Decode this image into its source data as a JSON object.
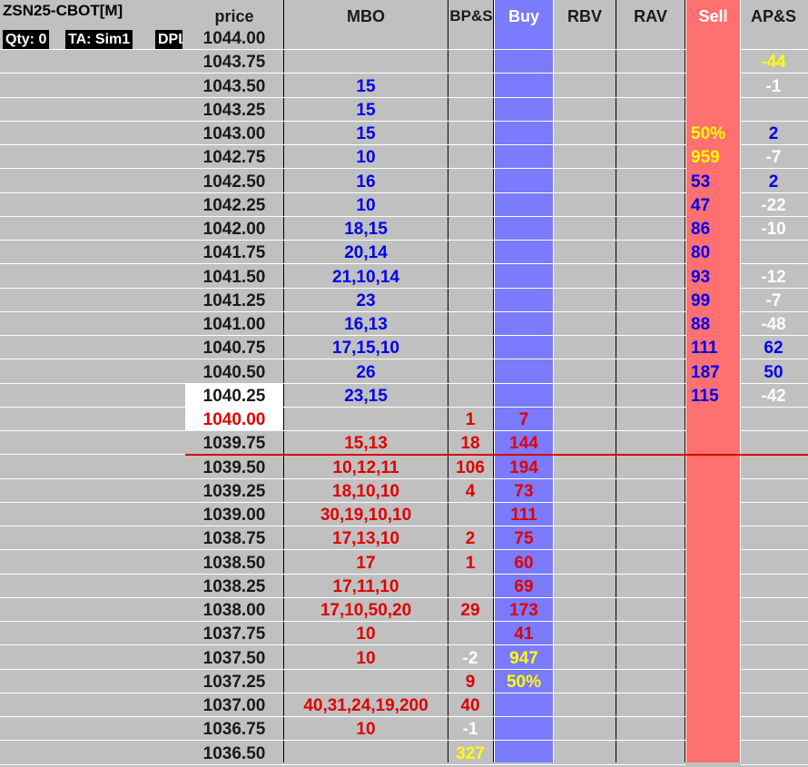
{
  "title": "ZSN25-CBOT[M]",
  "qty": "Qty: 0",
  "ta": "TA: Sim1",
  "dpl": "DPL",
  "headers": {
    "price": "price",
    "mbo": "MBO",
    "bps": "BP&S",
    "buy": "Buy",
    "rbv": "RBV",
    "rav": "RAV",
    "sell": "Sell",
    "aps": "AP&S"
  },
  "colors": {
    "background": "#c0c0c0",
    "buy_column": "#7b7bff",
    "sell_column": "#ff7171",
    "bid_text": "#e00000",
    "ask_text": "#0000ee",
    "last_trade_line": "#dd0000"
  },
  "rows": [
    {
      "price": "1044.00",
      "mbo": "",
      "bps": "",
      "buy": "",
      "sell": "",
      "aps": ""
    },
    {
      "price": "1043.75",
      "mbo": "",
      "bps": "",
      "buy": "",
      "sell": "",
      "aps": "-44",
      "aps_color": "yellow"
    },
    {
      "price": "1043.50",
      "mbo": "15",
      "mbo_color": "blue",
      "bps": "",
      "buy": "",
      "sell": "",
      "aps": "-1",
      "aps_color": "white"
    },
    {
      "price": "1043.25",
      "mbo": "15",
      "mbo_color": "blue",
      "bps": "",
      "buy": "",
      "sell": "",
      "aps": ""
    },
    {
      "price": "1043.00",
      "mbo": "15",
      "mbo_color": "blue",
      "bps": "",
      "buy": "",
      "sell": "50%",
      "sell_color": "yellow",
      "aps": "2",
      "aps_color": "blue"
    },
    {
      "price": "1042.75",
      "mbo": "10",
      "mbo_color": "blue",
      "bps": "",
      "buy": "",
      "sell": "959",
      "sell_color": "yellow",
      "aps": "-7",
      "aps_color": "white"
    },
    {
      "price": "1042.50",
      "mbo": "16",
      "mbo_color": "blue",
      "bps": "",
      "buy": "",
      "sell": "53",
      "sell_color": "blue",
      "aps": "2",
      "aps_color": "blue"
    },
    {
      "price": "1042.25",
      "mbo": "10",
      "mbo_color": "blue",
      "bps": "",
      "buy": "",
      "sell": "47",
      "sell_color": "blue",
      "aps": "-22",
      "aps_color": "white"
    },
    {
      "price": "1042.00",
      "mbo": "18,15",
      "mbo_color": "blue",
      "bps": "",
      "buy": "",
      "sell": "86",
      "sell_color": "blue",
      "aps": "-10",
      "aps_color": "white"
    },
    {
      "price": "1041.75",
      "mbo": "20,14",
      "mbo_color": "blue",
      "bps": "",
      "buy": "",
      "sell": "80",
      "sell_color": "blue",
      "aps": ""
    },
    {
      "price": "1041.50",
      "mbo": "21,10,14",
      "mbo_color": "blue",
      "bps": "",
      "buy": "",
      "sell": "93",
      "sell_color": "blue",
      "aps": "-12",
      "aps_color": "white"
    },
    {
      "price": "1041.25",
      "mbo": "23",
      "mbo_color": "blue",
      "bps": "",
      "buy": "",
      "sell": "99",
      "sell_color": "blue",
      "aps": "-7",
      "aps_color": "white"
    },
    {
      "price": "1041.00",
      "mbo": "16,13",
      "mbo_color": "blue",
      "bps": "",
      "buy": "",
      "sell": "88",
      "sell_color": "blue",
      "aps": "-48",
      "aps_color": "white"
    },
    {
      "price": "1040.75",
      "mbo": "17,15,10",
      "mbo_color": "blue",
      "bps": "",
      "buy": "",
      "sell": "111",
      "sell_color": "blue",
      "aps": "62",
      "aps_color": "blue"
    },
    {
      "price": "1040.50",
      "mbo": "26",
      "mbo_color": "blue",
      "bps": "",
      "buy": "",
      "sell": "187",
      "sell_color": "blue",
      "aps": "50",
      "aps_color": "blue"
    },
    {
      "price": "1040.25",
      "price_hl": true,
      "mbo": "23,15",
      "mbo_color": "blue",
      "bps": "",
      "buy": "",
      "sell": "115",
      "sell_color": "blue",
      "aps": "-42",
      "aps_color": "white"
    },
    {
      "price": "1040.00",
      "price_hl": true,
      "price_color": "red",
      "mbo": "",
      "bps": "1",
      "bps_color": "red",
      "buy": "7",
      "buy_color": "red",
      "sell": "",
      "aps": ""
    },
    {
      "price": "1039.75",
      "mbo": "15,13",
      "mbo_color": "red",
      "bps": "18",
      "bps_color": "red",
      "buy": "144",
      "buy_color": "red",
      "sell": "",
      "aps": ""
    },
    {
      "price": "1039.50",
      "mbo": "10,12,11",
      "mbo_color": "red",
      "bps": "106",
      "bps_color": "red",
      "buy": "194",
      "buy_color": "red",
      "sell": "",
      "aps": ""
    },
    {
      "price": "1039.25",
      "mbo": "18,10,10",
      "mbo_color": "red",
      "bps": "4",
      "bps_color": "red",
      "buy": "73",
      "buy_color": "red",
      "sell": "",
      "aps": ""
    },
    {
      "price": "1039.00",
      "mbo": "30,19,10,10",
      "mbo_color": "red",
      "bps": "",
      "buy": "111",
      "buy_color": "red",
      "sell": "",
      "aps": ""
    },
    {
      "price": "1038.75",
      "mbo": "17,13,10",
      "mbo_color": "red",
      "bps": "2",
      "bps_color": "red",
      "buy": "75",
      "buy_color": "red",
      "sell": "",
      "aps": ""
    },
    {
      "price": "1038.50",
      "mbo": "17",
      "mbo_color": "red",
      "bps": "1",
      "bps_color": "red",
      "buy": "60",
      "buy_color": "red",
      "sell": "",
      "aps": ""
    },
    {
      "price": "1038.25",
      "mbo": "17,11,10",
      "mbo_color": "red",
      "bps": "",
      "buy": "69",
      "buy_color": "red",
      "sell": "",
      "aps": ""
    },
    {
      "price": "1038.00",
      "mbo": "17,10,50,20",
      "mbo_color": "red",
      "bps": "29",
      "bps_color": "red",
      "buy": "173",
      "buy_color": "red",
      "sell": "",
      "aps": ""
    },
    {
      "price": "1037.75",
      "mbo": "10",
      "mbo_color": "red",
      "bps": "",
      "buy": "41",
      "buy_color": "red",
      "sell": "",
      "aps": ""
    },
    {
      "price": "1037.50",
      "mbo": "10",
      "mbo_color": "red",
      "bps": "-2",
      "bps_color": "white",
      "buy": "947",
      "buy_color": "yellow",
      "sell": "",
      "aps": ""
    },
    {
      "price": "1037.25",
      "mbo": "",
      "bps": "9",
      "bps_color": "red",
      "buy": "50%",
      "buy_color": "yellow",
      "sell": "",
      "aps": ""
    },
    {
      "price": "1037.00",
      "mbo": "40,31,24,19,200",
      "mbo_color": "red",
      "bps": "40",
      "bps_color": "red",
      "buy": "",
      "sell": "",
      "aps": ""
    },
    {
      "price": "1036.75",
      "mbo": "10",
      "mbo_color": "red",
      "bps": "-1",
      "bps_color": "white",
      "buy": "",
      "sell": "",
      "aps": ""
    },
    {
      "price": "1036.50",
      "mbo": "",
      "bps": "327",
      "bps_color": "yellow",
      "buy": "",
      "sell": "",
      "aps": ""
    }
  ]
}
